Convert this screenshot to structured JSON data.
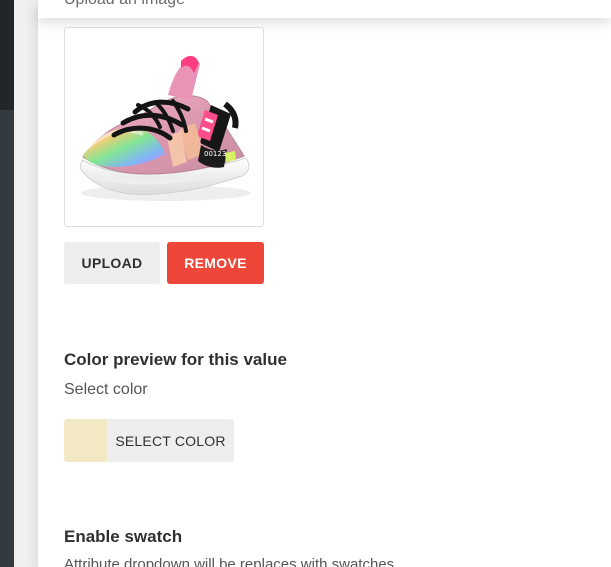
{
  "image_upload": {
    "clipped_label": "Upload an image",
    "upload_button": "UPLOAD",
    "remove_button": "REMOVE",
    "preview_name": "pink-sneaker-image"
  },
  "color_preview": {
    "title": "Color preview for this value",
    "subtitle": "Select color",
    "button_label": "SELECT COLOR",
    "swatch_color": "#f2e8c4"
  },
  "swatch_setting": {
    "title": "Enable swatch",
    "description": "Attribute dropdown will be replaces with swatches"
  },
  "colors": {
    "remove": "#ee473a",
    "button": "#eeeeee",
    "text": "#303030"
  }
}
